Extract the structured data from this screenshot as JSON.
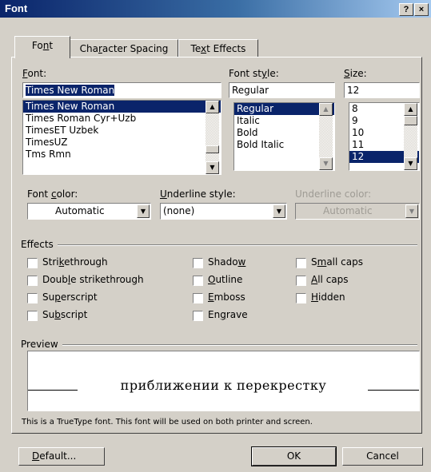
{
  "window": {
    "title": "Font",
    "help_label": "?",
    "close_label": "×"
  },
  "tabs": [
    {
      "pre": "Fo",
      "u": "n",
      "post": "t"
    },
    {
      "pre": "Cha",
      "u": "r",
      "post": "acter Spacing"
    },
    {
      "pre": "Te",
      "u": "x",
      "post": "t Effects"
    }
  ],
  "font": {
    "label_pre": "",
    "label_u": "F",
    "label_post": "ont:",
    "value": "Times New Roman",
    "items": [
      "Times New Roman",
      "Times Roman Cyr+Uzb",
      "TimesET Uzbek",
      "TimesUZ",
      "Tms Rmn"
    ]
  },
  "style": {
    "label_pre": "Font st",
    "label_u": "y",
    "label_post": "le:",
    "value": "Regular",
    "items": [
      "Regular",
      "Italic",
      "Bold",
      "Bold Italic"
    ]
  },
  "size": {
    "label_pre": "",
    "label_u": "S",
    "label_post": "ize:",
    "value": "12",
    "items": [
      "8",
      "9",
      "10",
      "11",
      "12"
    ]
  },
  "font_color": {
    "label_pre": "Font ",
    "label_u": "c",
    "label_post": "olor:",
    "value": "Automatic"
  },
  "underline_style": {
    "label_pre": "",
    "label_u": "U",
    "label_post": "nderline style:",
    "value": "(none)"
  },
  "underline_color": {
    "label": "Underline color:",
    "value": "Automatic"
  },
  "effects": {
    "title": "Effects",
    "col1": [
      {
        "pre": "Stri",
        "u": "k",
        "post": "ethrough"
      },
      {
        "pre": "Doub",
        "u": "l",
        "post": "e strikethrough"
      },
      {
        "pre": "Su",
        "u": "p",
        "post": "erscript"
      },
      {
        "pre": "Su",
        "u": "b",
        "post": "script"
      }
    ],
    "col2": [
      {
        "pre": "Shado",
        "u": "w",
        "post": ""
      },
      {
        "pre": "",
        "u": "O",
        "post": "utline"
      },
      {
        "pre": "",
        "u": "E",
        "post": "mboss"
      },
      {
        "pre": "En",
        "u": "g",
        "post": "rave"
      }
    ],
    "col3": [
      {
        "pre": "S",
        "u": "m",
        "post": "all caps"
      },
      {
        "pre": "",
        "u": "A",
        "post": "ll caps"
      },
      {
        "pre": "",
        "u": "H",
        "post": "idden"
      }
    ]
  },
  "preview": {
    "title": "Preview",
    "text": "приближении к перекрестку",
    "note": "This is a TrueType font. This font will be used on both printer and screen."
  },
  "buttons": {
    "default_pre": "",
    "default_u": "D",
    "default_post": "efault...",
    "ok": "OK",
    "cancel": "Cancel"
  }
}
